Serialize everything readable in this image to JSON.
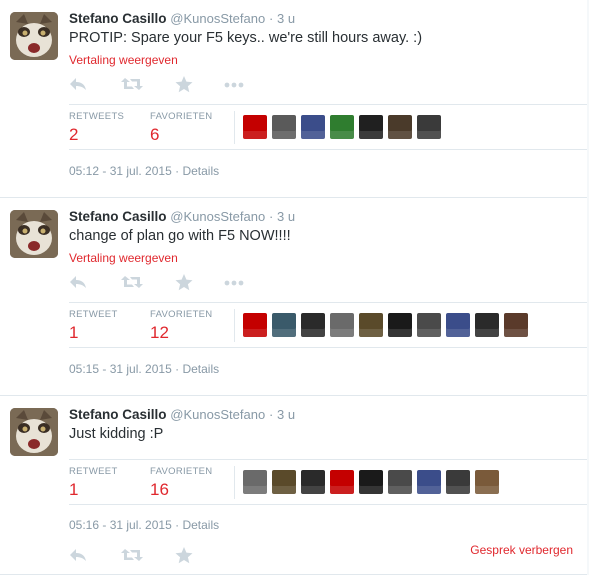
{
  "tweets": [
    {
      "name": "Stefano Casillo",
      "handle": "@KunosStefano",
      "time": "3 u",
      "text": "PROTIP: Spare your F5 keys.. we're still hours away. :)",
      "translate": "Vertaling weergeven",
      "retweets_label": "RETWEETS",
      "retweets": "2",
      "favorites_label": "FAVORIETEN",
      "favorites": "6",
      "timestamp": "05:12 - 31 jul. 2015",
      "details": "Details",
      "avatar_colors": [
        "#c40000",
        "#5a5a5a",
        "#3b4d8a",
        "#2f7d2f",
        "#202020",
        "#4a3a2a",
        "#3a3a3a"
      ]
    },
    {
      "name": "Stefano Casillo",
      "handle": "@KunosStefano",
      "time": "3 u",
      "text": "change of plan go with F5 NOW!!!!",
      "translate": "Vertaling weergeven",
      "retweets_label": "RETWEET",
      "retweets": "1",
      "favorites_label": "FAVORIETEN",
      "favorites": "12",
      "timestamp": "05:15 - 31 jul. 2015",
      "details": "Details",
      "avatar_colors": [
        "#c40000",
        "#3a5a6a",
        "#2a2a2a",
        "#6a6a6a",
        "#5a4a2a",
        "#1a1a1a",
        "#4a4a4a",
        "#3b4d8a",
        "#2a2a2a",
        "#5a3a2a"
      ]
    },
    {
      "name": "Stefano Casillo",
      "handle": "@KunosStefano",
      "time": "3 u",
      "text": "Just kidding :P",
      "retweets_label": "RETWEET",
      "retweets": "1",
      "favorites_label": "FAVORIETEN",
      "favorites": "16",
      "timestamp": "05:16 - 31 jul. 2015",
      "details": "Details",
      "avatar_colors": [
        "#6a6a6a",
        "#5a4a2a",
        "#2a2a2a",
        "#c40000",
        "#1a1a1a",
        "#4a4a4a",
        "#3b4d8a",
        "#3a3a3a",
        "#7a5a3a"
      ]
    }
  ],
  "hide_conversation": "Gesprek verbergen",
  "colors": {
    "accent": "#e0282e",
    "muted": "#8899a6",
    "icon": "#ccd6dd"
  }
}
